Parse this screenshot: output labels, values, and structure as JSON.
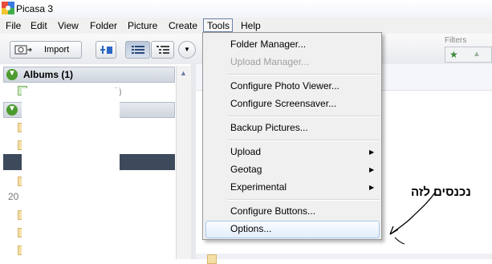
{
  "window": {
    "title": "Picasa 3"
  },
  "menubar": {
    "items": [
      "File",
      "Edit",
      "View",
      "Folder",
      "Picture",
      "Create",
      "Tools",
      "Help"
    ]
  },
  "toolbar": {
    "import_label": "Import",
    "filters_label": "Filters"
  },
  "left_pane": {
    "albums_header": "Albums (1)",
    "album_item_partial": "3)",
    "year_partial": "20"
  },
  "tools_menu": {
    "items": [
      {
        "label": "Folder Manager...",
        "disabled": false
      },
      {
        "label": "Upload Manager...",
        "disabled": true
      },
      {
        "label": "Configure Photo Viewer...",
        "disabled": false
      },
      {
        "label": "Configure Screensaver...",
        "disabled": false
      },
      {
        "label": "Backup Pictures...",
        "disabled": false
      },
      {
        "label": "Upload",
        "submenu": true
      },
      {
        "label": "Geotag",
        "submenu": true
      },
      {
        "label": "Experimental",
        "submenu": true
      },
      {
        "label": "Configure Buttons...",
        "disabled": false
      },
      {
        "label": "Options...",
        "highlighted": true
      }
    ]
  },
  "annotation": {
    "text": "נכנסים לזה"
  },
  "colors": {
    "accent": "#4d9b2f",
    "selection": "#3d4a5c",
    "menu_highlight": "#a8c8ea"
  }
}
